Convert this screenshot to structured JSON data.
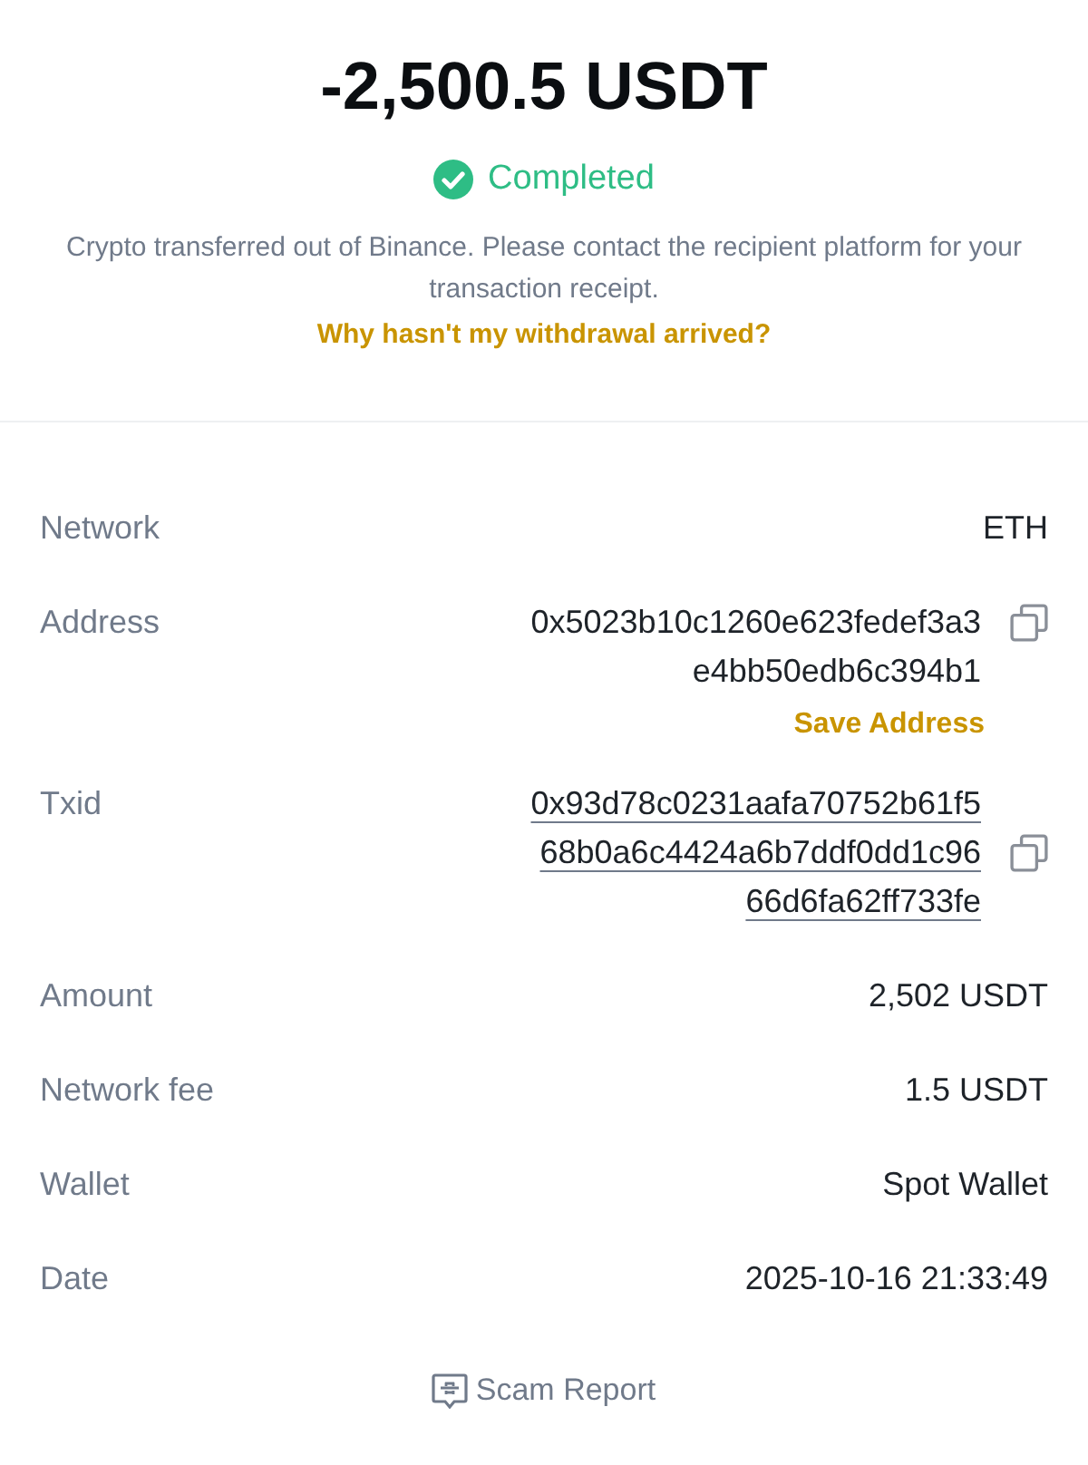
{
  "amount": "-2,500.5 USDT",
  "status": {
    "label": "Completed",
    "kind": "success"
  },
  "description": "Crypto transferred out of Binance. Please contact the recipient platform for your transaction receipt.",
  "help_link": "Why hasn't my withdrawal arrived?",
  "details": [
    {
      "label": "Network",
      "kind": "plain",
      "value_lines": [
        "ETH"
      ]
    },
    {
      "label": "Address",
      "kind": "copy",
      "value_lines": [
        "0x5023b10c1260e623fedef3a3",
        "e4bb50edb6c394b1"
      ],
      "action": "Save Address"
    },
    {
      "label": "Txid",
      "kind": "link-copy",
      "value_lines": [
        "0x93d78c0231aafa70752b61f5",
        "68b0a6c4424a6b7ddf0dd1c96",
        "66d6fa62ff733fe"
      ]
    },
    {
      "label": "Amount",
      "kind": "plain",
      "value_lines": [
        "2,502 USDT"
      ]
    },
    {
      "label": "Network fee",
      "kind": "plain",
      "value_lines": [
        "1.5 USDT"
      ]
    },
    {
      "label": "Wallet",
      "kind": "plain",
      "value_lines": [
        "Spot Wallet"
      ]
    },
    {
      "label": "Date",
      "kind": "plain",
      "value_lines": [
        "2025-10-16 21:33:49"
      ]
    }
  ],
  "footer_link": "Scam Report"
}
